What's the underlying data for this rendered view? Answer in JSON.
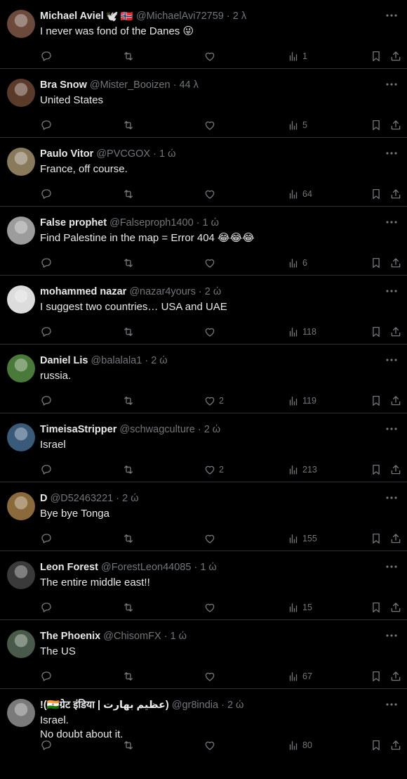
{
  "tweets": [
    {
      "name": "Michael Aviel",
      "badges": [
        "🕊️",
        "🇳🇴"
      ],
      "handle": "@MichaelAvi72759",
      "time": "2 λ",
      "text": "I never was fond of the Danes 😜",
      "likes": "",
      "views": "1",
      "avatar": "#6b4a3c"
    },
    {
      "name": "Bra Snow",
      "badges": [],
      "handle": "@Mister_Booizen",
      "time": "44 λ",
      "text": "United States",
      "likes": "",
      "views": "5",
      "avatar": "#5a3b2a"
    },
    {
      "name": "Paulo Vitor",
      "badges": [],
      "handle": "@PVCGOX",
      "time": "1 ώ",
      "text": "France, off course.",
      "likes": "",
      "views": "64",
      "avatar": "#8a7a5c"
    },
    {
      "name": "False prophet",
      "badges": [],
      "handle": "@Falseproph1400",
      "time": "1 ώ",
      "text": "Find Palestine in the map = Error 404 😂😂😂",
      "likes": "",
      "views": "6",
      "avatar": "#9c9c9c"
    },
    {
      "name": "mohammed nazar",
      "badges": [],
      "handle": "@nazar4yours",
      "time": "2 ώ",
      "text": "I suggest two countries… USA and UAE",
      "likes": "",
      "views": "118",
      "avatar": "#dcdcdc"
    },
    {
      "name": "Daniel Lis",
      "badges": [],
      "handle": "@balalala1",
      "time": "2 ώ",
      "text": "russia.",
      "likes": "2",
      "views": "119",
      "avatar": "#4a7a3a"
    },
    {
      "name": "TimeisaStripper",
      "badges": [],
      "handle": "@schwagculture",
      "time": "2 ώ",
      "text": "Israel",
      "likes": "2",
      "views": "213",
      "avatar": "#3a5a7a"
    },
    {
      "name": "D",
      "badges": [],
      "handle": "@D52463221",
      "time": "2 ώ",
      "text": "Bye bye Tonga",
      "likes": "",
      "views": "155",
      "avatar": "#8a6a3a"
    },
    {
      "name": "Leon Forest",
      "badges": [],
      "handle": "@ForestLeon44085",
      "time": "1 ώ",
      "text": "The entire middle east!!",
      "likes": "",
      "views": "15",
      "avatar": "#3a3a3a"
    },
    {
      "name": "The Phoenix",
      "badges": [],
      "handle": "@ChisomFX",
      "time": "1 ώ",
      "text": "The US",
      "likes": "",
      "views": "67",
      "avatar": "#4a5a4a"
    },
    {
      "name": "!(🇮🇳ग्रेट इंडिया | عظیم بھارت)",
      "badges": [],
      "handle": "@gr8india",
      "time": "2 ώ",
      "text": "Israel.\nNo doubt about it.",
      "likes": "",
      "views": "80",
      "avatar": "#7a7a7a"
    }
  ],
  "icons": {
    "more": "more-icon",
    "reply": "reply-icon",
    "retweet": "retweet-icon",
    "like": "heart-icon",
    "views": "views-icon",
    "bookmark": "bookmark-icon",
    "share": "share-icon"
  }
}
